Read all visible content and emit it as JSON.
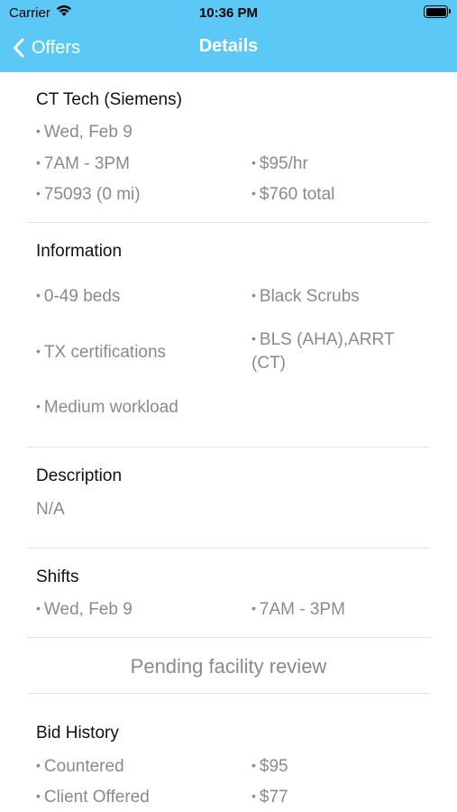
{
  "status_bar": {
    "carrier": "Carrier",
    "time": "10:36 PM"
  },
  "nav": {
    "back_label": "Offers",
    "title": "Details"
  },
  "job": {
    "title": "CT Tech (Siemens)",
    "date": "Wed, Feb 9",
    "hours": "7AM - 3PM",
    "rate": "$95/hr",
    "location": "75093 (0 mi)",
    "total": "$760 total"
  },
  "information": {
    "title": "Information",
    "items": [
      "0-49 beds",
      "Black Scrubs",
      "TX certifications",
      "BLS (AHA),ARRT (CT)",
      "Medium workload"
    ]
  },
  "description": {
    "title": "Description",
    "value": "N/A"
  },
  "shifts": {
    "title": "Shifts",
    "date": "Wed, Feb 9",
    "hours": "7AM - 3PM"
  },
  "status": {
    "text": "Pending facility review"
  },
  "bid_history": {
    "title": "Bid History",
    "rows": [
      {
        "label": "Countered",
        "amount": "$95"
      },
      {
        "label": "Client Offered",
        "amount": "$77"
      }
    ]
  }
}
